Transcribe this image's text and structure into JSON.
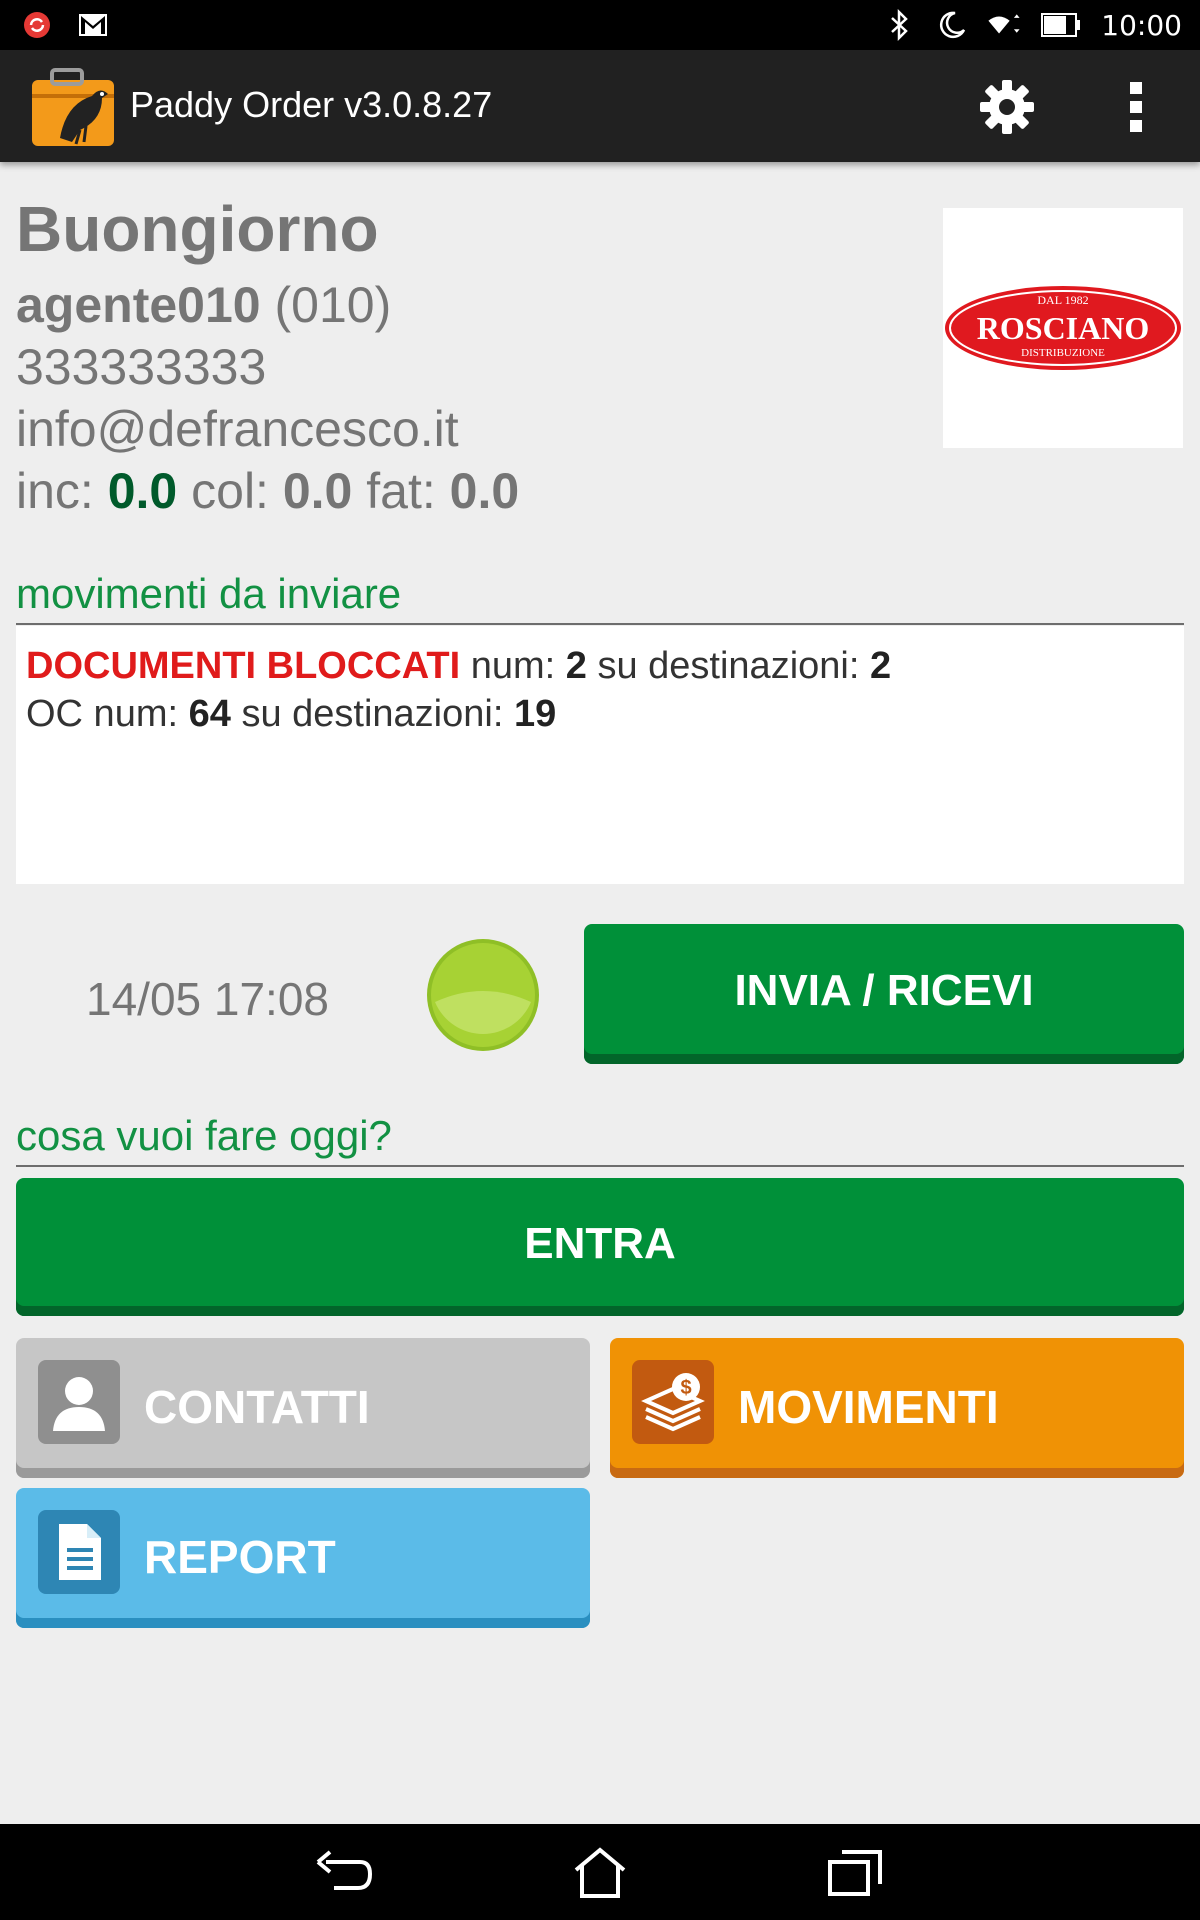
{
  "status_bar": {
    "time": "10:00",
    "left_icons": [
      "sync-alert-icon",
      "gmail-icon"
    ],
    "right_icons": [
      "bluetooth-icon",
      "moon-icon",
      "wifi-icon",
      "battery-icon"
    ]
  },
  "action_bar": {
    "title": "Paddy Order v3.0.8.27",
    "icons": [
      "app-logo-icon",
      "gear-icon",
      "more-vert-icon"
    ]
  },
  "header": {
    "greeting": "Buongiorno",
    "agent_name": "agente010",
    "agent_code": "(010)",
    "phone": "333333333",
    "email": "info@defrancesco.it",
    "stats": {
      "inc_label": "inc:",
      "inc_value": "0.0",
      "col_label": "col:",
      "col_value": "0.0",
      "fat_label": "fat:",
      "fat_value": "0.0"
    },
    "brand_logo": {
      "top": "DAL 1982",
      "name": "ROSCIANO",
      "bottom": "DISTRIBUZIONE"
    }
  },
  "movimenti": {
    "title": "movimenti da inviare",
    "line1": {
      "label": "DOCUMENTI BLOCCATI",
      "num_label": "num:",
      "num": "2",
      "dest_label": "su destinazioni:",
      "dest": "2"
    },
    "line2": {
      "label": "OC num:",
      "num": "64",
      "dest_label": "su destinazioni:",
      "dest": "19"
    }
  },
  "sync": {
    "last_sync": "14/05 17:08",
    "button_label": "INVIA / RICEVI"
  },
  "actions": {
    "title": "cosa vuoi fare oggi?",
    "enter_label": "ENTRA",
    "tiles": [
      {
        "label": "CONTATTI",
        "icon": "person-icon"
      },
      {
        "label": "MOVIMENTI",
        "icon": "money-stack-icon"
      },
      {
        "label": "REPORT",
        "icon": "document-icon"
      }
    ]
  },
  "colors": {
    "primary_green": "#009039",
    "section_green": "#129143",
    "alert_red": "#e01b1b",
    "orange": "#f09205",
    "blue": "#5bbbe8",
    "gray_tile": "#c6c6c6"
  },
  "nav_bar": {
    "icons": [
      "back-icon",
      "home-icon",
      "recents-icon"
    ]
  }
}
